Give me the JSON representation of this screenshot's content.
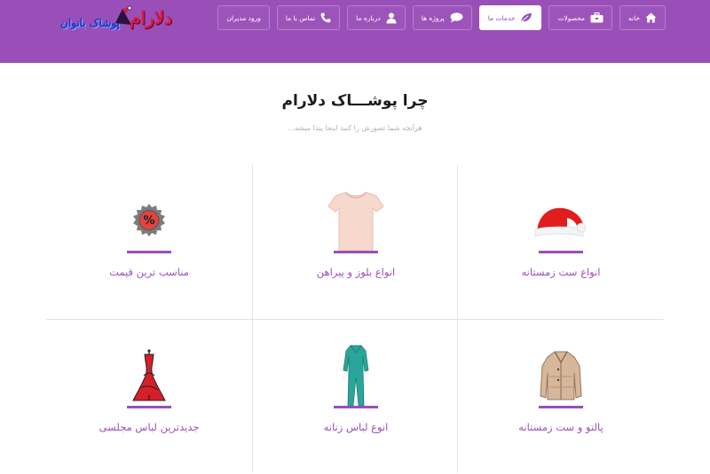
{
  "header": {
    "logo": {
      "brand": "دلارام",
      "subtitle": "پوشاک بانوان"
    },
    "nav": [
      {
        "id": "home",
        "label": "خانه",
        "icon": "home-icon",
        "active": false
      },
      {
        "id": "products",
        "label": "محصولات",
        "icon": "briefcase-icon",
        "active": false
      },
      {
        "id": "services",
        "label": "خدمات ما",
        "icon": "leaf-icon",
        "active": true
      },
      {
        "id": "projects",
        "label": "پروژه ها",
        "icon": "chat-bubble-icon",
        "active": false
      },
      {
        "id": "about",
        "label": "درباره ما",
        "icon": "user-icon",
        "active": false
      },
      {
        "id": "contact",
        "label": "تماس با ما",
        "icon": "phone-icon",
        "active": false
      },
      {
        "id": "admin-login",
        "label": "ورود مدیران",
        "icon": "",
        "active": false
      }
    ]
  },
  "section": {
    "title": "چرا پوشـــاک دلارام",
    "subtitle": "هرآنچه شما تصورش را کنید اینجا پیدا میشه..."
  },
  "features": [
    {
      "label": "انواع ست زمستانه",
      "icon": "santa-hat-icon"
    },
    {
      "label": "انواع بلوز و پیراهن",
      "icon": "tshirt-icon"
    },
    {
      "label": "مناسب ترین قیمت",
      "icon": "discount-badge-icon"
    },
    {
      "label": "پالتو و ست زمستانه",
      "icon": "coat-icon"
    },
    {
      "label": "انوع لباس زنانه",
      "icon": "jumpsuit-icon"
    },
    {
      "label": "جدیدترین لباس مجلسی",
      "icon": "evening-dress-icon"
    }
  ],
  "colors": {
    "accent": "#9a4fb8",
    "header_bg": "#9a4fb8",
    "logo_brand": "#d81b43",
    "logo_subtitle": "#1438c8",
    "divider": "#e3e3e3",
    "subtitle_text": "#b2b2b2"
  }
}
